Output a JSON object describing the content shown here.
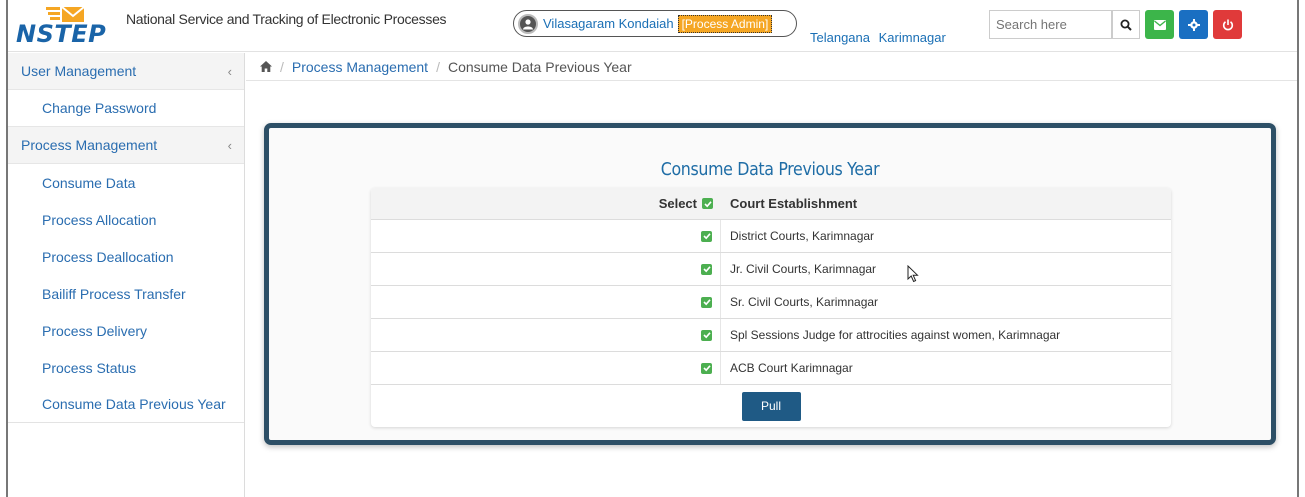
{
  "header": {
    "logo_text": "NSTEP",
    "app_title": "National Service and Tracking of Electronic Processes",
    "user_name": "Vilasagaram Kondaiah",
    "role": "[Process Admin]",
    "location_state": "Telangana",
    "location_district": "Karimnagar",
    "search_placeholder": "Search here",
    "icons": [
      "search-icon",
      "envelope-icon",
      "gear-icon",
      "power-icon"
    ],
    "colors": {
      "mail": "#3cb54a",
      "settings": "#1a6fc2",
      "logout": "#e03a3a",
      "role_badge": "#f5a623"
    }
  },
  "sidebar": {
    "groups": [
      {
        "label": "User Management",
        "items": [
          {
            "label": "Change Password"
          }
        ]
      },
      {
        "label": "Process Management",
        "items": [
          {
            "label": "Consume Data"
          },
          {
            "label": "Process Allocation"
          },
          {
            "label": "Process Deallocation"
          },
          {
            "label": "Bailiff Process Transfer"
          },
          {
            "label": "Process Delivery"
          },
          {
            "label": "Process Status"
          },
          {
            "label": "Consume Data Previous Year"
          }
        ]
      }
    ]
  },
  "breadcrumb": {
    "section": "Process Management",
    "current": "Consume Data Previous Year"
  },
  "main": {
    "title": "Consume Data Previous Year",
    "table": {
      "col_select": "Select",
      "col_court": "Court Establishment",
      "rows": [
        {
          "court": "District Courts, Karimnagar",
          "checked": true
        },
        {
          "court": "Jr. Civil Courts, Karimnagar",
          "checked": true
        },
        {
          "court": "Sr. Civil Courts, Karimnagar",
          "checked": true
        },
        {
          "court": "Spl Sessions Judge for attrocities against women, Karimnagar",
          "checked": true
        },
        {
          "court": "ACB Court Karimnagar",
          "checked": true
        }
      ]
    },
    "pull_label": "Pull"
  }
}
